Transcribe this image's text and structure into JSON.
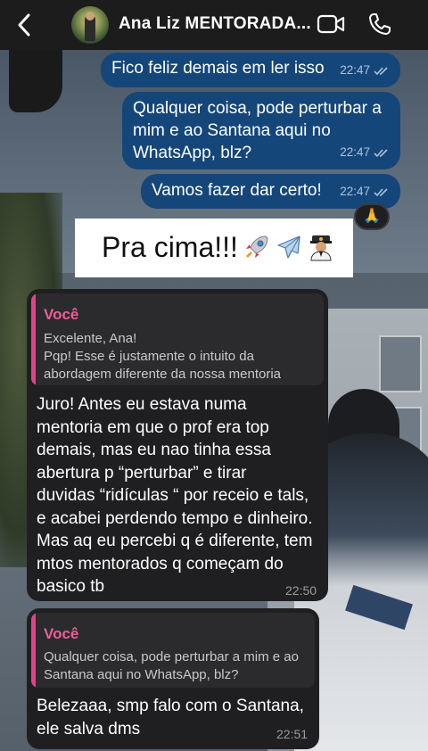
{
  "header": {
    "contact_name": "Ana Liz MENTORADA...",
    "icons": [
      "chevron-left-icon",
      "video-camera-icon",
      "phone-icon"
    ]
  },
  "messages_out": [
    {
      "text": "Fico feliz demais em ler isso",
      "time": "22:47"
    },
    {
      "text": "Qualquer coisa, pode perturbar a mim e ao Santana aqui no WhatsApp, blz?",
      "line1": "Qualquer coisa, pode perturbar a",
      "line2": "mim e ao Santana aqui no",
      "line3": "WhatsApp, blz?",
      "time": "22:47"
    },
    {
      "text": "Vamos fazer dar certo!",
      "time": "22:47",
      "reaction": "🙏"
    }
  ],
  "caption": {
    "text": "Pra cima!!!",
    "emojis": [
      "rocket",
      "airplane",
      "pilot"
    ]
  },
  "messages_in": [
    {
      "quote_author": "Você",
      "quote_line1": "Excelente, Ana!",
      "quote_line2": "Pqp! Esse é justamente o intuito da",
      "quote_line3": "abordagem diferente da nossa mentoria",
      "body_lines": [
        "Juro! Antes eu estava numa",
        "mentoria em que o prof era top",
        "demais, mas eu nao tinha essa",
        "abertura p “perturbar” e tirar",
        "duvidas “ridículas “ por receio e tals,",
        "e acabei perdendo tempo e dinheiro.",
        "Mas aq eu percebi q é diferente, tem",
        "mtos mentorados q começam do",
        "basico tb"
      ],
      "time": "22:50"
    },
    {
      "quote_author": "Você",
      "quote_line1": "Qualquer coisa, pode perturbar a mim e ao",
      "quote_line2": "Santana aqui no WhatsApp, blz?",
      "body_lines": [
        "Belezaaa, smp falo com o Santana,",
        "ele salva dms"
      ],
      "time": "22:51"
    }
  ],
  "colors": {
    "header_bg": "#1c1c1d",
    "outgoing_bubble": "#15467a",
    "incoming_bubble": "#1f1f21",
    "quote_accent": "#e1438b"
  }
}
